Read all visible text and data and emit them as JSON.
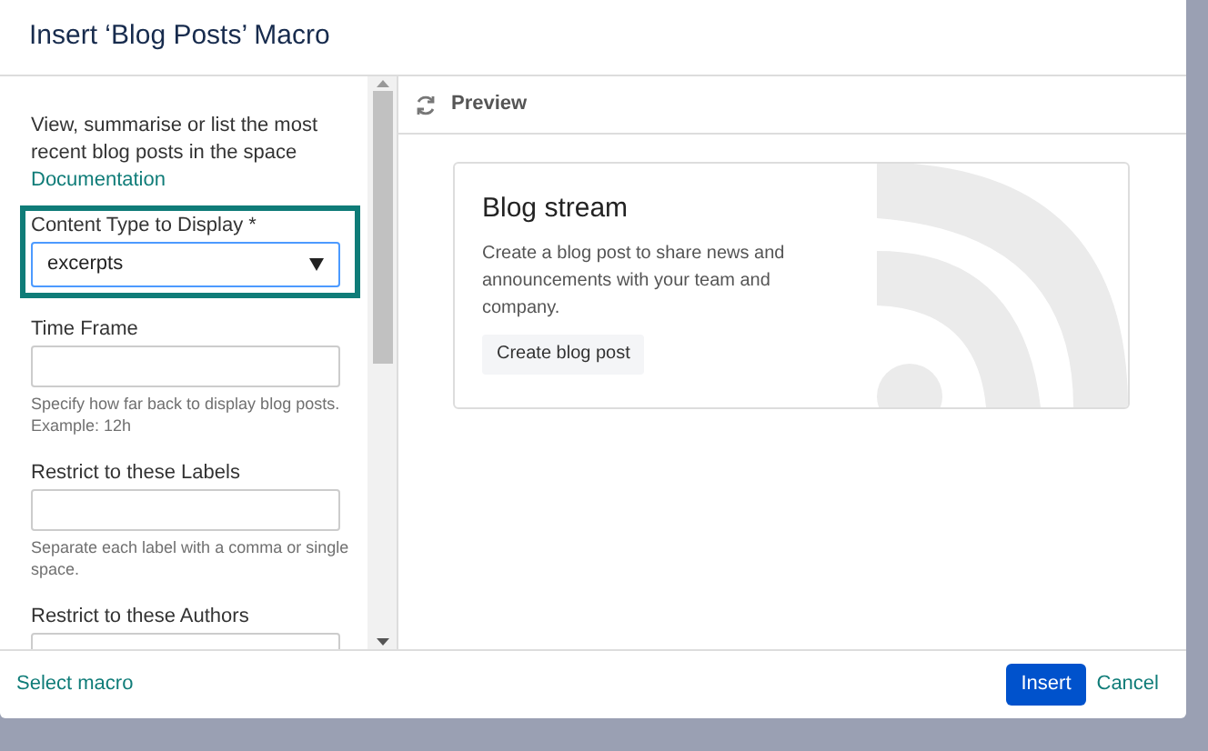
{
  "dialog": {
    "title": "Insert ‘Blog Posts’ Macro"
  },
  "sidebar": {
    "description": "View, summarise or list the most recent blog posts in the space",
    "link": "Documentation",
    "fields": [
      {
        "kind": "select",
        "label": "Content Type to Display *",
        "value": "excerpts",
        "focused": true
      },
      {
        "kind": "text",
        "label": "Time Frame",
        "hint": "Specify how far back to display blog posts. Example: 12h",
        "focused": false
      },
      {
        "kind": "text",
        "label": "Restrict to these Labels",
        "hint": "Separate each label with a comma or single space.",
        "focused": false
      },
      {
        "kind": "text",
        "label": "Restrict to these Authors",
        "focused": false
      }
    ]
  },
  "preview": {
    "title": "Preview",
    "card": {
      "heading": "Blog stream",
      "text": "Create a blog post to share news and announcements with your team and company.",
      "button": "Create blog post"
    }
  },
  "footer": {
    "link": "Select macro",
    "primary": "Insert",
    "cancel": "Cancel"
  }
}
